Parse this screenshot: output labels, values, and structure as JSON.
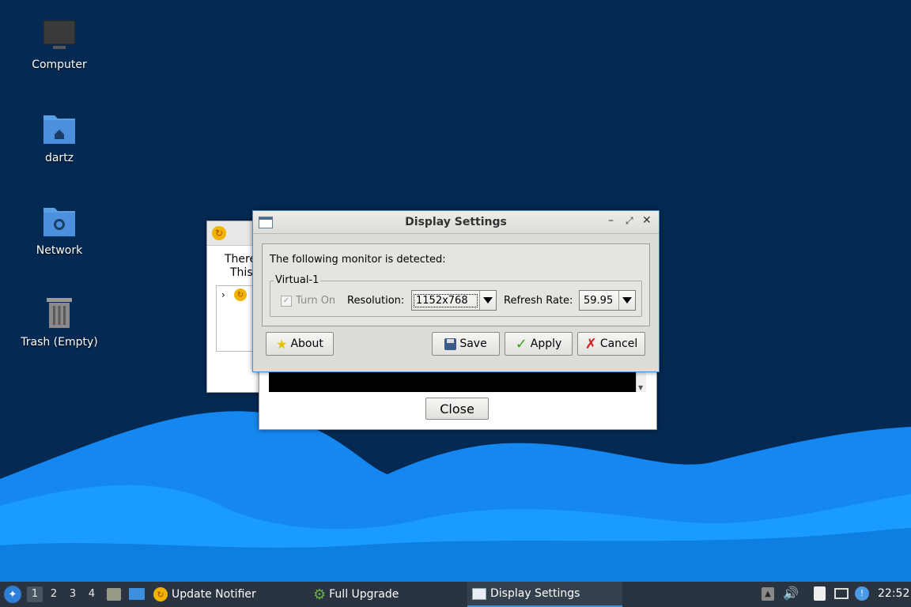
{
  "desktop": {
    "icons": [
      {
        "label": "Computer"
      },
      {
        "label": "dartz"
      },
      {
        "label": "Network"
      },
      {
        "label": "Trash (Empty)"
      }
    ]
  },
  "update_window": {
    "text_line1": "There",
    "text_line2": "This",
    "close_label": "Close"
  },
  "display_settings": {
    "title": "Display Settings",
    "detected_text": "The following monitor is detected:",
    "monitor_name": "Virtual-1",
    "turn_on_label": "Turn On",
    "turn_on_checked": true,
    "resolution_label": "Resolution:",
    "resolution_value": "1152x768",
    "refresh_label": "Refresh Rate:",
    "refresh_value": "59.95",
    "buttons": {
      "about": "About",
      "save": "Save",
      "apply": "Apply",
      "cancel": "Cancel"
    },
    "titlebar_controls": [
      "minimize-icon",
      "maximize-icon",
      "close-icon"
    ]
  },
  "taskbar": {
    "workspaces": [
      "1",
      "2",
      "3",
      "4"
    ],
    "active_workspace": "1",
    "tasks": [
      {
        "label": "Update Notifier",
        "icon": "update-notifier-icon"
      },
      {
        "label": "Full Upgrade",
        "icon": "gear-icon"
      },
      {
        "label": "Display Settings",
        "icon": "window-icon",
        "active": true
      }
    ],
    "clock": "22:52"
  },
  "colors": {
    "background": "#042a54",
    "wave_light": "#1a8fff",
    "taskbar": "#2a3440",
    "active_task_underline": "#3d8fe0"
  }
}
